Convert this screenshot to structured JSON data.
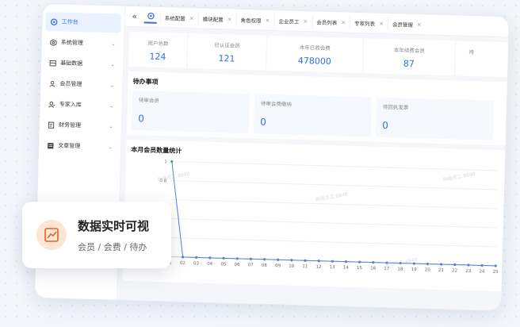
{
  "sidebar": {
    "items": [
      {
        "label": "工作台",
        "icon": "dashboard-icon",
        "active": true
      },
      {
        "label": "系统管理",
        "icon": "settings-icon"
      },
      {
        "label": "基础数据",
        "icon": "database-icon"
      },
      {
        "label": "会员管理",
        "icon": "user-icon"
      },
      {
        "label": "专家入库",
        "icon": "expert-icon"
      },
      {
        "label": "财务管理",
        "icon": "finance-icon"
      },
      {
        "label": "文章管理",
        "icon": "article-icon"
      }
    ]
  },
  "tabs": {
    "collapse": "«",
    "items": [
      "系统配置",
      "模块配置",
      "角色权限",
      "企业员工",
      "会员列表",
      "专家列表",
      "会员管理"
    ]
  },
  "stats": [
    {
      "label": "用户总数",
      "value": "124"
    },
    {
      "label": "已认证会员",
      "value": "121"
    },
    {
      "label": "本年已收会费",
      "value": "478000"
    },
    {
      "label": "本年续费会员",
      "value": "87"
    },
    {
      "label": "待",
      "value": ""
    }
  ],
  "todo": {
    "title": "待办事项",
    "cards": [
      {
        "label": "待审会员",
        "value": "0"
      },
      {
        "label": "待审会费缴纳",
        "value": "0"
      },
      {
        "label": "待回执发票",
        "value": "0"
      }
    ]
  },
  "chart": {
    "title": "本月会员数量统计"
  },
  "watermark": "网络员工 8840",
  "float_card": {
    "title": "数据实时可视",
    "subtitle": "会员 / 会费 / 待办",
    "icon": "line-chart-icon"
  },
  "colors": {
    "accent": "#2f6fe6",
    "icon_bg": "#fde6d4",
    "icon_stroke": "#e0612b"
  },
  "chart_data": {
    "type": "line",
    "title": "本月会员数量统计",
    "xlabel": "",
    "ylabel": "",
    "x": [
      "01",
      "02",
      "03",
      "04",
      "05",
      "06",
      "07",
      "08",
      "09",
      "10",
      "11",
      "12",
      "13",
      "14",
      "15",
      "16",
      "17",
      "18",
      "19",
      "20",
      "21",
      "22",
      "23",
      "24",
      "25"
    ],
    "series": [
      {
        "values": [
          1,
          0,
          0,
          0,
          0,
          0,
          0,
          0,
          0,
          0,
          0,
          0,
          0,
          0,
          0,
          0,
          0,
          0,
          0,
          0,
          0,
          0,
          0,
          0,
          0
        ]
      }
    ],
    "yticks": [
      "1",
      "0.8"
    ],
    "ylim": [
      0,
      1
    ],
    "grid": true,
    "color": "#5b7fd6"
  }
}
